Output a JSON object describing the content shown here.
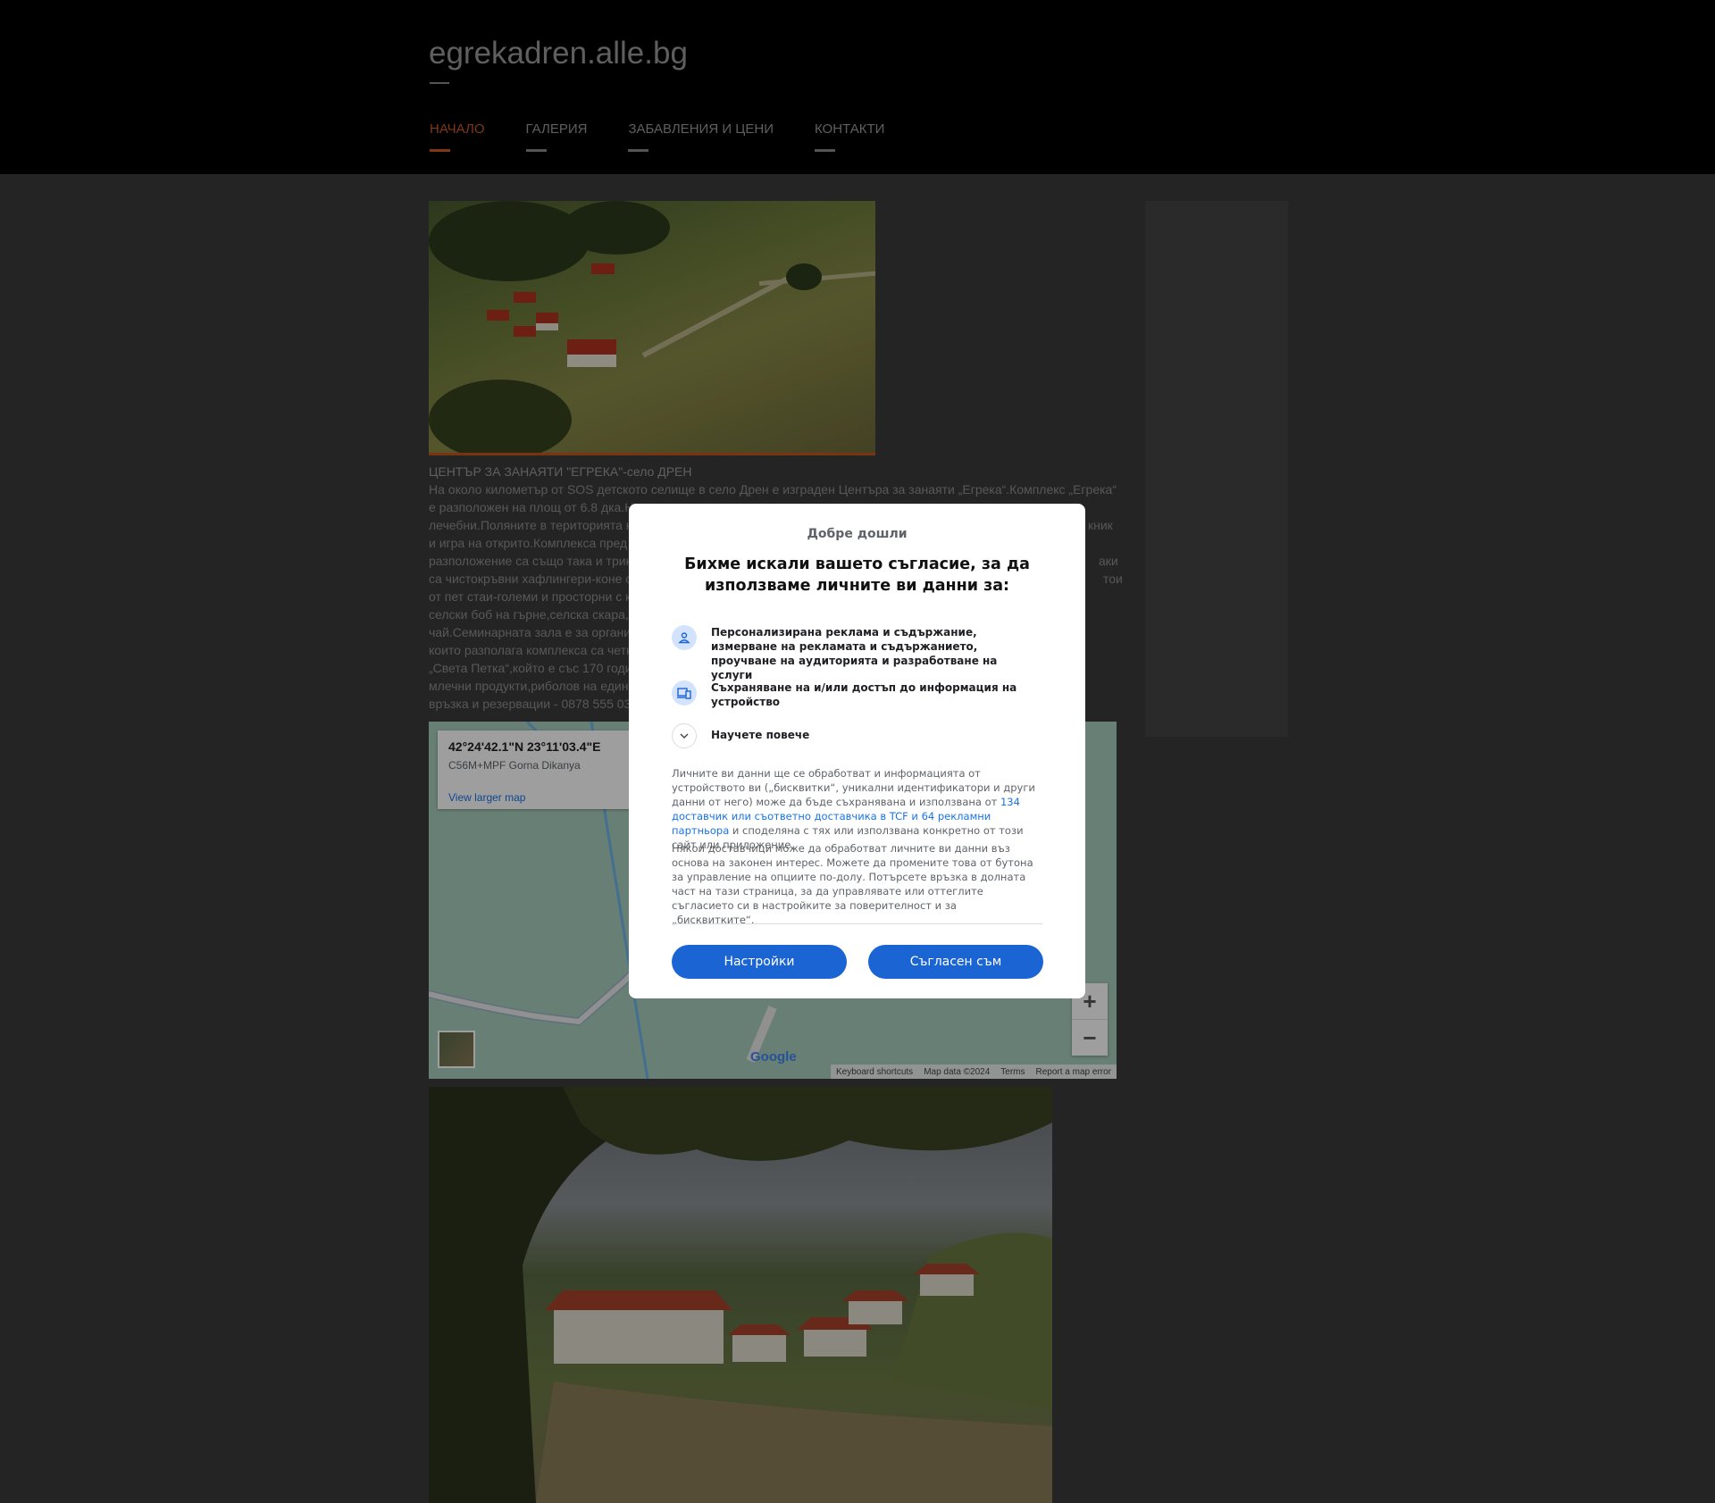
{
  "site": {
    "title": "egrekadren.alle.bg"
  },
  "nav": {
    "items": [
      {
        "label": "НАЧАЛО",
        "active": true
      },
      {
        "label": "ГАЛЕРИЯ",
        "active": false
      },
      {
        "label": "ЗАБАВЛЕНИЯ И ЦЕНИ",
        "active": false
      },
      {
        "label": "КОНТАКТИ",
        "active": false
      }
    ]
  },
  "content": {
    "heading": "ЦЕНТЪР ЗА ЗАНАЯТИ \"ЕГРЕКА\"-село ДРЕН",
    "lines": [
      "На около километър от SOS детското селище в село Дрен е изграден Центъра за занаяти „Егрека“.Комплекс „Егрека“",
      "е разположен на площ от 6.8 дка.Н",
      "лечебни.Поляните в територията к",
      "и игра на открито.Комплекса пред",
      "разположение са също така и трик",
      "са чистокръвни хафлингери-коне с",
      "от пет стаи-големи и просторни с к",
      "селски боб на гърне,селска скара,",
      "чай.Семинарната зала е за органи",
      "които разполага комплекса са четк",
      "„Света Петка“,който е със 170 годи",
      "млечни продукти,риболов на един",
      "връзка и резервации - 0878 555 03"
    ],
    "right_fragments": [
      "кник",
      "аки",
      "тои"
    ]
  },
  "map": {
    "coords": "42°24'42.1\"N 23°11'03.4\"E",
    "plus_code": "C56M+MPF Gorna Dikanya",
    "larger_link": "View larger map",
    "footer": [
      "Keyboard shortcuts",
      "Map data ©2024",
      "Terms",
      "Report a map error"
    ],
    "zoom_in": "+",
    "zoom_out": "−",
    "logo": "Google"
  },
  "consent": {
    "welcome": "Добре дошли",
    "title": "Бихме искали вашето съгласие, за да използваме личните ви данни за:",
    "purposes": [
      {
        "icon": "person-icon",
        "text": "Персонализирана реклама и съдържание, измерване на рекламата и съдържанието, проучване на аудиторията и разработване на услуги"
      },
      {
        "icon": "devices-icon",
        "text": "Съхраняване на и/или достъп до информация на устройство"
      }
    ],
    "learn_more": "Научете повече",
    "para1_before": "Личните ви данни ще се обработват и информацията от устройството ви („бисквитки“, уникални идентификатори и други данни от него) може да бъде съхранявана и използвана от ",
    "para1_link": "134 доставчик или съответно доставчика в TCF и 64 рекламни партньора",
    "para1_after": " и споделяна с тях или използвана конкретно от този сайт или приложение.",
    "para2": "Някои доставчици може да обработват личните ви данни въз основа на законен интерес. Можете да промените това от бутона за управление на опциите по-долу. Потърсете връзка в долната част на тази страница, за да управлявате или оттеглите съгласието си в настройките за поверителност и за „бисквитките“.",
    "btn_settings": "Настройки",
    "btn_accept": "Съгласен съм"
  },
  "colors": {
    "accent": "#d05a1e",
    "button": "#1a64d4",
    "link": "#1a73e8"
  }
}
